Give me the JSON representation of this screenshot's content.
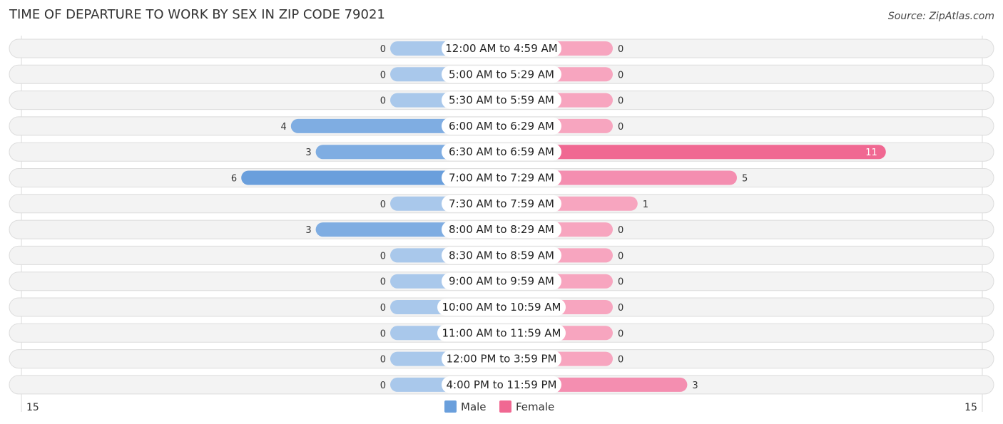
{
  "title": "TIME OF DEPARTURE TO WORK BY SEX IN ZIP CODE 79021",
  "source": "Source: ZipAtlas.com",
  "colors": {
    "male": "#6a9fdc",
    "male_light": "#a9c8eb",
    "female": "#f06892",
    "female_light": "#f7a5bf",
    "row_bg": "#f3f3f3"
  },
  "chart_data": {
    "type": "bar",
    "orientation": "horizontal-diverging",
    "title": "TIME OF DEPARTURE TO WORK BY SEX IN ZIP CODE 79021",
    "categories": [
      "12:00 AM to 4:59 AM",
      "5:00 AM to 5:29 AM",
      "5:30 AM to 5:59 AM",
      "6:00 AM to 6:29 AM",
      "6:30 AM to 6:59 AM",
      "7:00 AM to 7:29 AM",
      "7:30 AM to 7:59 AM",
      "8:00 AM to 8:29 AM",
      "8:30 AM to 8:59 AM",
      "9:00 AM to 9:59 AM",
      "10:00 AM to 10:59 AM",
      "11:00 AM to 11:59 AM",
      "12:00 PM to 3:59 PM",
      "4:00 PM to 11:59 PM"
    ],
    "series": [
      {
        "name": "Male",
        "values": [
          0,
          0,
          0,
          4,
          3,
          6,
          0,
          3,
          0,
          0,
          0,
          0,
          0,
          0
        ]
      },
      {
        "name": "Female",
        "values": [
          0,
          0,
          0,
          0,
          11,
          5,
          1,
          0,
          0,
          0,
          0,
          0,
          0,
          3
        ]
      }
    ],
    "xlim": [
      -15,
      15
    ],
    "axis_labels": {
      "left": "15",
      "right": "15"
    },
    "legend": {
      "position": "bottom-center",
      "entries": [
        "Male",
        "Female"
      ]
    },
    "grid": false
  }
}
